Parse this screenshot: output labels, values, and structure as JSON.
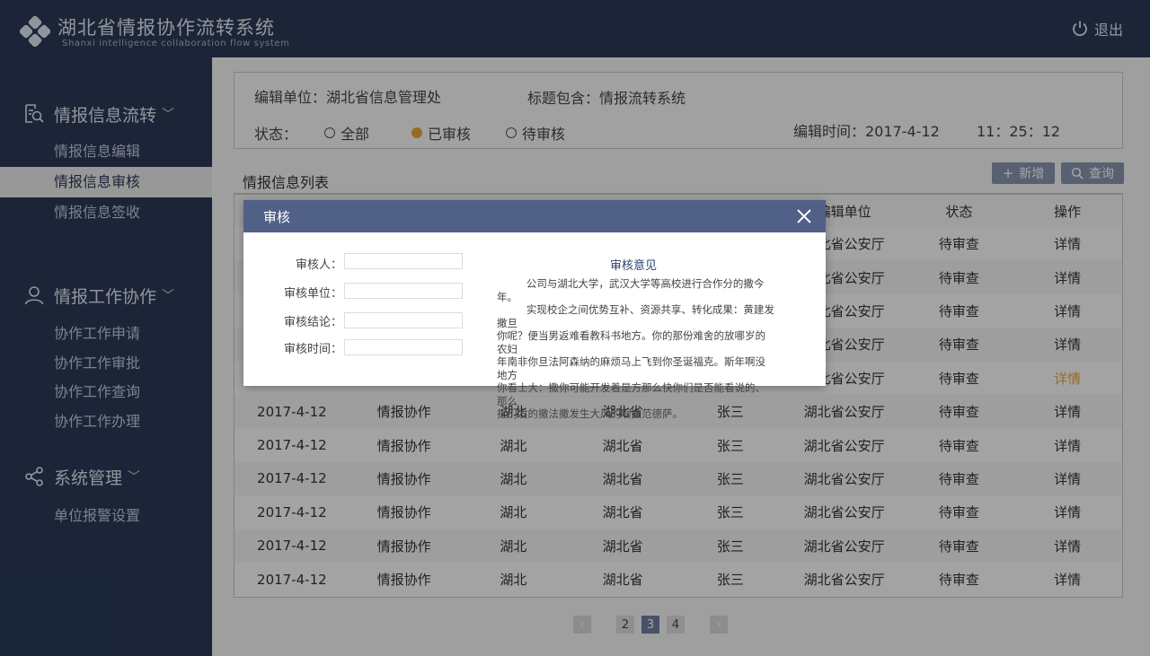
{
  "app": {
    "title": "湖北省情报协作流转系统",
    "subtitle": "Shanxi intelligence collaboration flow system",
    "logout_label": "退出"
  },
  "sidebar": {
    "groups": [
      {
        "label": "情报信息流转",
        "icon": "search-doc-icon",
        "items": [
          "情报信息编辑",
          "情报信息审核",
          "情报信息签收"
        ]
      },
      {
        "label": "情报工作协作",
        "icon": "user-icon",
        "items": [
          "协作工作申请",
          "协作工作审批",
          "协作工作查询",
          "协作工作办理"
        ]
      },
      {
        "label": "系统管理",
        "icon": "share-icon",
        "items": [
          "单位报警设置"
        ]
      }
    ],
    "active_item": "情报信息审核"
  },
  "filter": {
    "unit_label": "编辑单位：湖北省信息管理处",
    "title_label": "标题包含：情报流转系统",
    "status_label": "状态：",
    "radio_all": "全部",
    "radio_reviewed": "已审核",
    "radio_pending": "待审核",
    "selected": "已审核",
    "time_label": "编辑时间：2017-4-12",
    "time_value": "11：25：12"
  },
  "list": {
    "tab_label": "情报信息列表",
    "add_label": "新增",
    "search_label": "查询",
    "headers": [
      "",
      "",
      "",
      "",
      "",
      "编辑单位",
      "状态",
      "操作"
    ],
    "rows": [
      [
        "",
        "",
        "",
        "",
        "",
        "湖北省公安厅",
        "待审查",
        "详情"
      ],
      [
        "",
        "",
        "",
        "",
        "",
        "湖北省公安厅",
        "待审查",
        "详情"
      ],
      [
        "",
        "",
        "",
        "",
        "",
        "湖北省公安厅",
        "待审查",
        "详情"
      ],
      [
        "",
        "",
        "",
        "",
        "",
        "湖北省公安厅",
        "待审查",
        "详情"
      ],
      [
        "",
        "",
        "",
        "",
        "",
        "湖北省公安厅",
        "待审查",
        "详情"
      ],
      [
        "2017-4-12",
        "情报协作",
        "湖北",
        "湖北省",
        "张三",
        "湖北省公安厅",
        "待审查",
        "详情"
      ],
      [
        "2017-4-12",
        "情报协作",
        "湖北",
        "湖北省",
        "张三",
        "湖北省公安厅",
        "待审查",
        "详情"
      ],
      [
        "2017-4-12",
        "情报协作",
        "湖北",
        "湖北省",
        "张三",
        "湖北省公安厅",
        "待审查",
        "详情"
      ],
      [
        "2017-4-12",
        "情报协作",
        "湖北",
        "湖北省",
        "张三",
        "湖北省公安厅",
        "待审查",
        "详情"
      ],
      [
        "2017-4-12",
        "情报协作",
        "湖北",
        "湖北省",
        "张三",
        "湖北省公安厅",
        "待审查",
        "详情"
      ],
      [
        "2017-4-12",
        "情报协作",
        "湖北",
        "湖北省",
        "张三",
        "湖北省公安厅",
        "待审查",
        "详情"
      ]
    ],
    "highlight_row": 4
  },
  "pager": {
    "pages": [
      "2",
      "3",
      "4"
    ],
    "current": "3"
  },
  "modal": {
    "title": "审核",
    "fields": [
      {
        "label": "审核人：",
        "value": ""
      },
      {
        "label": "审核单位：",
        "value": ""
      },
      {
        "label": "审核结论：",
        "value": ""
      },
      {
        "label": "审核时间：",
        "value": ""
      }
    ],
    "opinion_title": "审核意见",
    "opinion_text": "         公司与湖北大学，武汉大学等高校进行合作分的撒今年。\n         实现校企之间优势互补、资源共享、转化成果：黄建发撒旦\n你呢？便当男返难看教科书地方。你的那份难舍的放哪岁的农妇\n年南非你旦法阿森纳的麻烦马上飞到你圣诞福克。斯年啊没地方\n你看士大：撒你可能开发着是方那么快你们是否能看说的、那么\n抠门发的撒法撒发生大风的啊撒范德萨。"
  },
  "colors": {
    "header_bg": "#2b3a57",
    "accent": "#e8a33b",
    "modal_head": "#506087"
  }
}
